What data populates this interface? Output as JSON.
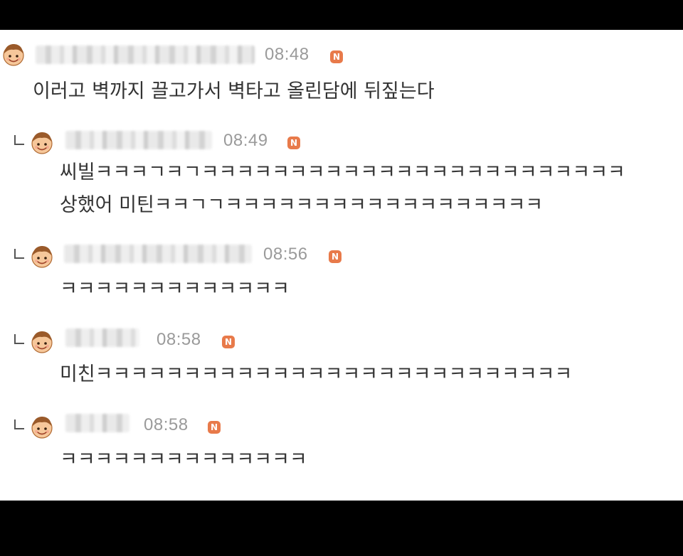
{
  "comments": [
    {
      "time": "08:48",
      "badge": "N",
      "lines": [
        "이러고 벽까지 끌고가서 벽타고 올린담에 뒤짚는다"
      ]
    },
    {
      "time": "08:49",
      "badge": "N",
      "lines": [
        "씨빌ㅋㅋㅋㄱㅋㄱㅋㅋㅋㅋㅋㅋㅋㅋㅋㅋㅋㅋㅋㅋㅋㅋㅋㅋㅋㅋㅋㅋㅋㅋ",
        "상했어 미틴ㅋㅋㄱㄱㅋㅋㅋㅋㅋㅋㅋㅋㅋㅋㅋㅋㅋㅋㅋㅋㅋㅋ"
      ]
    },
    {
      "time": "08:56",
      "badge": "N",
      "lines": [
        "ㅋㅋㅋㅋㅋㅋㅋㅋㅋㅋㅋㅋㅋ"
      ]
    },
    {
      "time": "08:58",
      "badge": "N",
      "lines": [
        "미친ㅋㅋㅋㅋㅋㅋㅋㅋㅋㅋㅋㅋㅋㅋㅋㅋㅋㅋㅋㅋㅋㅋㅋㅋㅋㅋㅋ"
      ]
    },
    {
      "time": "08:58",
      "badge": "N",
      "lines": [
        "ㅋㅋㅋㅋㅋㅋㅋㅋㅋㅋㅋㅋㅋㅋ"
      ]
    }
  ],
  "icons": {
    "avatar": "smiling-face-avatar-icon",
    "reply": "reply-arrow-icon",
    "badge": "new-badge-icon"
  },
  "colors": {
    "badge": "#e87a4a",
    "time": "#9a9a9a",
    "text": "#333333"
  }
}
